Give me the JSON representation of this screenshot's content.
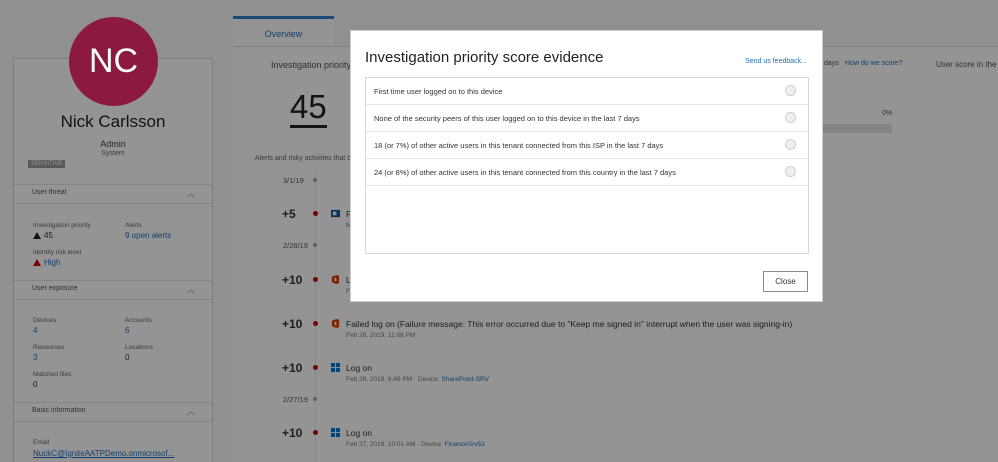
{
  "profile": {
    "initials": "NC",
    "name": "Nick Carlsson",
    "role": "Admin",
    "sub": "System",
    "badge": "SENSITIVE",
    "colors": {
      "avatar": "#8c1a3f",
      "link": "#1f6fb7"
    }
  },
  "user_threat": {
    "title": "User threat",
    "investigation_label": "Investigation priority",
    "investigation_value": "45",
    "alerts_label": "Alerts",
    "alerts_value": "9 open alerts",
    "risk_label": "Identity risk level",
    "risk_value": "High"
  },
  "user_exposure": {
    "title": "User exposure",
    "devices_label": "Devices",
    "devices_value": "4",
    "accounts_label": "Accounts",
    "accounts_value": "6",
    "resources_label": "Resources",
    "resources_value": "3",
    "locations_label": "Locations",
    "locations_value": "0",
    "files_label": "Matched files",
    "files_value": "0"
  },
  "basic_info": {
    "title": "Basic information",
    "email_label": "Email",
    "email_value": "NuckC@IgniteAATPDemo.onmicrosof..."
  },
  "main": {
    "tab_label": "Overview",
    "inv_priority_label": "Investigation priority",
    "score": "45",
    "alerts_caption": "Alerts and risky activities that c",
    "days_text": "days",
    "how_score": "How do we score?",
    "user_score": "User score in the",
    "percent": "0%"
  },
  "timeline": [
    {
      "type": "date",
      "text": "3/1/19"
    },
    {
      "type": "activity",
      "points": "+5",
      "icon": "outlook-icon",
      "title": "P",
      "subtitle": "M"
    },
    {
      "type": "date",
      "text": "2/28/19"
    },
    {
      "type": "activity",
      "points": "+10",
      "icon": "office-icon",
      "title": "L",
      "subtitle": "F"
    },
    {
      "type": "activity",
      "points": "+10",
      "icon": "office-icon",
      "title": "Failed log on (Failure message: This error occurred due to \"Keep me signed in\" interrupt when the user was signing-in)",
      "subtitle": "Feb 28, 2019, 11:08 PM"
    },
    {
      "type": "activity",
      "points": "+10",
      "icon": "windows-icon",
      "title": "Log on",
      "subtitle": "Feb 28, 2019, 6:49 PM · Device:",
      "device": "SharePoint-SRV"
    },
    {
      "type": "date",
      "text": "2/27/19"
    },
    {
      "type": "activity",
      "points": "+10",
      "icon": "windows-icon",
      "title": "Log on",
      "subtitle": "Feb 27, 2019, 10:01 AM · Device:",
      "device": "FinanceSrv53"
    }
  ],
  "modal": {
    "title": "Investigation priority score evidence",
    "feedback": "Send us feedback...",
    "evidence": [
      "First time user logged on to this device",
      "None of the security peers of this user logged on to this device in the last 7 days",
      "18 (or 7%) of other active users in this tenant connected from this ISP in the last 7 days",
      "24 (or 8%) of other active users in this tenant connected from this country in the last 7 days"
    ],
    "close_label": "Close"
  }
}
